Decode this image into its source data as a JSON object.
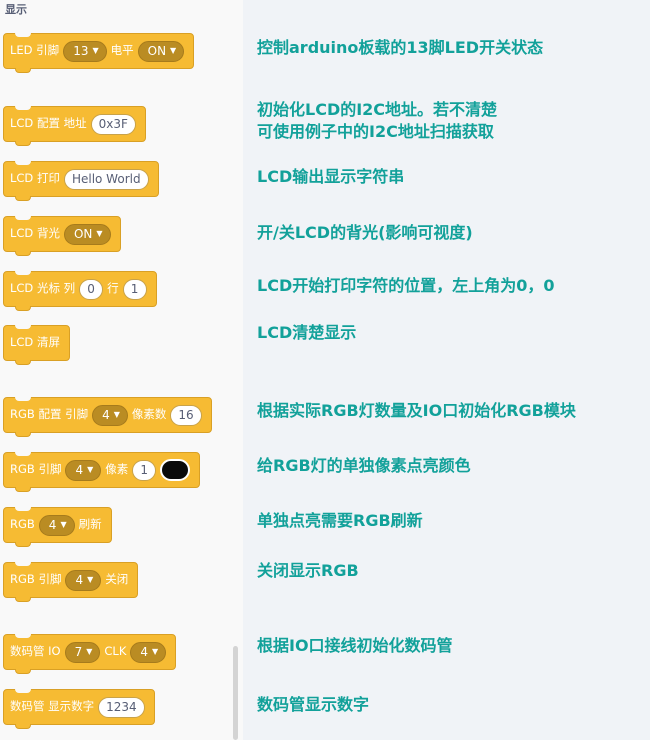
{
  "palette": {
    "section_title": "显示"
  },
  "blocks": {
    "led": {
      "label": "LED 引脚",
      "pin": "13",
      "label2": "电平",
      "level": "ON"
    },
    "lcd_config": {
      "label": "LCD 配置 地址",
      "address": "0x3F"
    },
    "lcd_print": {
      "label": "LCD 打印",
      "text": "Hello World"
    },
    "lcd_backlight": {
      "label": "LCD 背光",
      "state": "ON"
    },
    "lcd_cursor": {
      "label": "LCD 光标 列",
      "col": "0",
      "label2": "行",
      "row": "1"
    },
    "lcd_clear": {
      "label": "LCD 清屏"
    },
    "rgb_config": {
      "label": "RGB 配置 引脚",
      "pin": "4",
      "label2": "像素数",
      "count": "16"
    },
    "rgb_pixel": {
      "label": "RGB 引脚",
      "pin": "4",
      "label2": "像素",
      "index": "1",
      "color": "#0a0a0a"
    },
    "rgb_refresh": {
      "label": "RGB",
      "pin": "4",
      "label2": "刷新"
    },
    "rgb_off": {
      "label": "RGB 引脚",
      "pin": "4",
      "label2": "关闭"
    },
    "seg_init": {
      "label": "数码管 IO",
      "io": "7",
      "label2": "CLK",
      "clk": "4"
    },
    "seg_show": {
      "label": "数码管 显示数字",
      "number": "1234"
    }
  },
  "notes": [
    "控制arduino板载的13脚LED开关状态",
    "初始化LCD的I2C地址。若不清楚\n可使用例子中的I2C地址扫描获取",
    "LCD输出显示字符串",
    "开/关LCD的背光(影响可视度)",
    "LCD开始打印字符的位置，左上角为0，0",
    "LCD清楚显示",
    "根据实际RGB灯数量及IO口初始化RGB模块",
    "给RGB灯的单独像素点亮颜色",
    "单独点亮需要RGB刷新",
    "关闭显示RGB",
    "根据IO口接线初始化数码管",
    "数码管显示数字"
  ]
}
